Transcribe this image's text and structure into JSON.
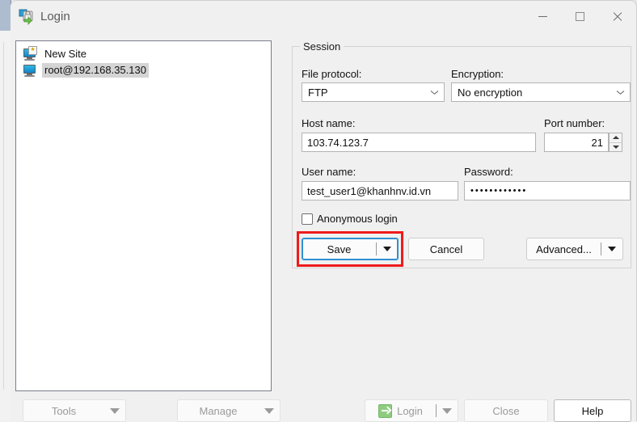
{
  "window": {
    "title": "Login",
    "icon": "winscp-login-icon",
    "caption_buttons": [
      {
        "name": "minimize",
        "glyph": "minimize-icon"
      },
      {
        "name": "maximize",
        "glyph": "maximize-icon"
      },
      {
        "name": "close",
        "glyph": "close-icon"
      }
    ]
  },
  "sites_tree": {
    "items": [
      {
        "label": "New Site",
        "icon": "new-site-icon",
        "selected": false
      },
      {
        "label": "root@192.168.35.130",
        "icon": "site-icon",
        "selected": true
      }
    ]
  },
  "session": {
    "legend": "Session",
    "file_protocol": {
      "label": "File protocol:",
      "value": "FTP"
    },
    "encryption": {
      "label": "Encryption:",
      "value": "No encryption"
    },
    "host_name": {
      "label": "Host name:",
      "value": "103.74.123.7",
      "placeholder": ""
    },
    "port_number": {
      "label": "Port number:",
      "value": "21"
    },
    "user_name": {
      "label": "User name:",
      "value": "test_user1@khanhnv.id.vn",
      "placeholder": ""
    },
    "password": {
      "label": "Password:",
      "value": "••••••••••••",
      "placeholder": ""
    },
    "anonymous_login": {
      "label": "Anonymous login",
      "checked": false
    },
    "buttons": {
      "save": "Save",
      "cancel": "Cancel",
      "advanced": "Advanced..."
    }
  },
  "footer": {
    "tools": "Tools",
    "manage": "Manage",
    "login": "Login",
    "close": "Close",
    "help": "Help"
  },
  "colors": {
    "highlight": "#ee1b1b",
    "focus": "#2f8fd0",
    "window_bg": "#f0f0f0",
    "field_bg": "#ffffff",
    "disabled_text": "#9a9a9a"
  }
}
